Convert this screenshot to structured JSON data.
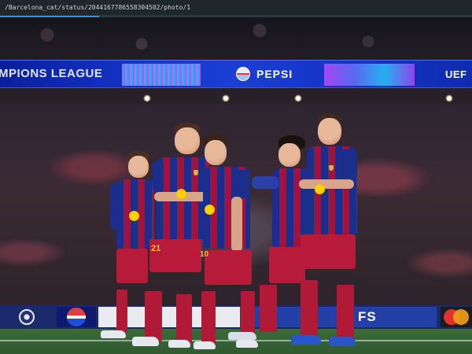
{
  "browser": {
    "url": "/Barcelona_cat/status/2044167786558304502/photo/1",
    "load_progress_percent": 21
  },
  "banner": {
    "left_text": "MPIONS LEAGUE",
    "center_text": "PEPSI",
    "right_text": "UEF"
  },
  "ad_boards": {
    "blue_board_text": "FS"
  },
  "players": {
    "shorts_numbers": [
      "21",
      "10"
    ]
  },
  "colors": {
    "home_blue": "#1c2e8c",
    "home_garnet": "#a3123a",
    "banner_blue": "#1535c8",
    "sponsor_yellow": "#ffd100",
    "pitch_green": "#2f5a2f"
  },
  "icons": [
    "ucl-starball-icon",
    "pepsi-globe-icon",
    "mastercard-logo-icon"
  ]
}
